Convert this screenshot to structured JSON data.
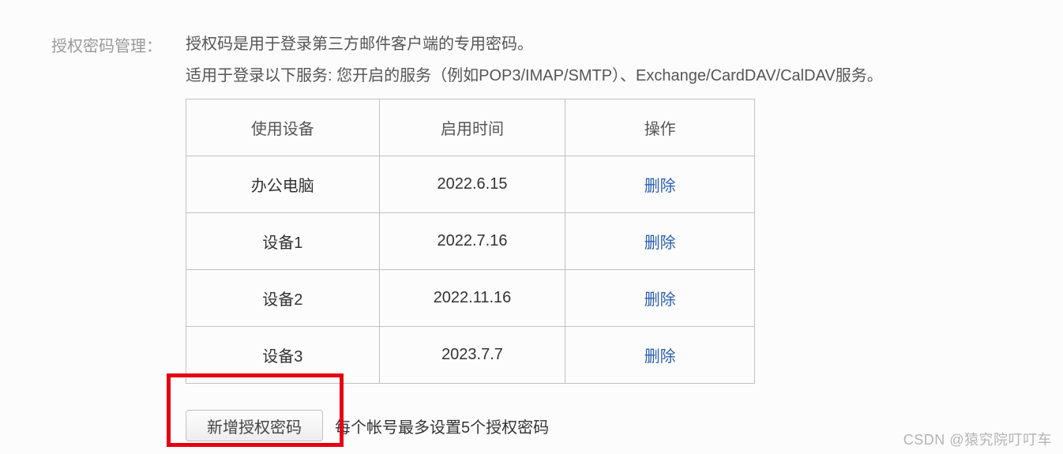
{
  "section": {
    "label": "授权密码管理："
  },
  "intro": {
    "line1": "授权码是用于登录第三方邮件客户端的专用密码。",
    "line2": "适用于登录以下服务: 您开启的服务（例如POP3/IMAP/SMTP）、Exchange/CardDAV/CalDAV服务。"
  },
  "table": {
    "headers": {
      "device": "使用设备",
      "time": "启用时间",
      "action": "操作"
    },
    "rows": [
      {
        "device": "办公电脑",
        "time": "2022.6.15",
        "action": "删除"
      },
      {
        "device": "设备1",
        "time": "2022.7.16",
        "action": "删除"
      },
      {
        "device": "设备2",
        "time": "2022.11.16",
        "action": "删除"
      },
      {
        "device": "设备3",
        "time": "2023.7.7",
        "action": "删除"
      }
    ]
  },
  "footer": {
    "add_button": "新增授权密码",
    "limit_text": "每个帐号最多设置5个授权密码"
  },
  "watermark": "CSDN @猿究院叮叮车"
}
